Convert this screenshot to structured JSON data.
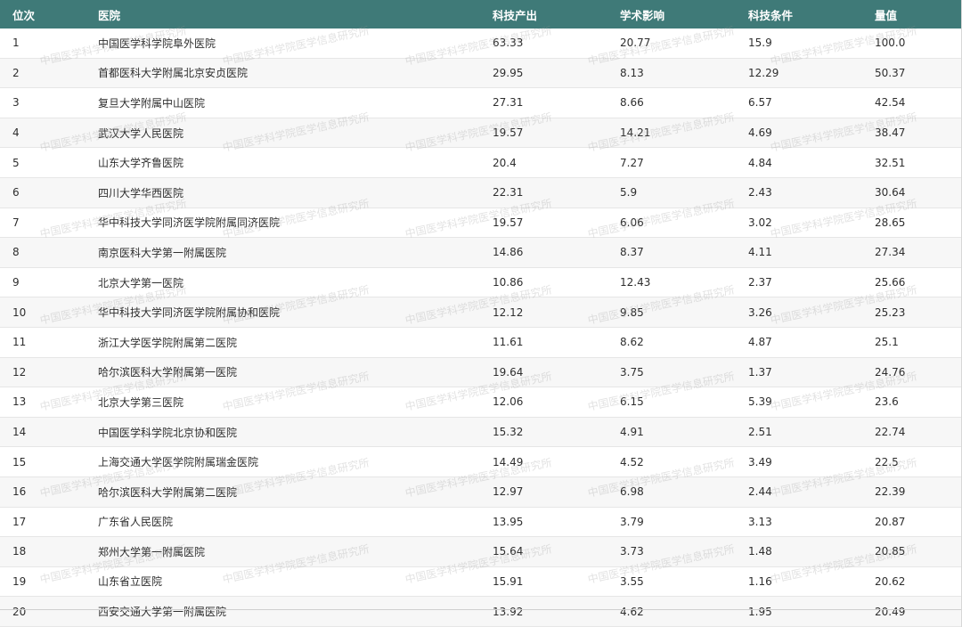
{
  "columns": {
    "rank": "位次",
    "hospital": "医院",
    "output": "科技产出",
    "academic": "学术影响",
    "conditions": "科技条件",
    "score": "量值"
  },
  "watermark_text": "中国医学科学院医学信息研究所",
  "colors": {
    "header_bg": "#3f7a78",
    "header_text": "#ffffff",
    "alt_row_bg": "#f7f7f7"
  },
  "rows": [
    {
      "rank": "1",
      "hospital": "中国医学科学院阜外医院",
      "output": "63.33",
      "academic": "20.77",
      "conditions": "15.9",
      "score": "100.0"
    },
    {
      "rank": "2",
      "hospital": "首都医科大学附属北京安贞医院",
      "output": "29.95",
      "academic": "8.13",
      "conditions": "12.29",
      "score": "50.37"
    },
    {
      "rank": "3",
      "hospital": "复旦大学附属中山医院",
      "output": "27.31",
      "academic": "8.66",
      "conditions": "6.57",
      "score": "42.54"
    },
    {
      "rank": "4",
      "hospital": "武汉大学人民医院",
      "output": "19.57",
      "academic": "14.21",
      "conditions": "4.69",
      "score": "38.47"
    },
    {
      "rank": "5",
      "hospital": "山东大学齐鲁医院",
      "output": "20.4",
      "academic": "7.27",
      "conditions": "4.84",
      "score": "32.51"
    },
    {
      "rank": "6",
      "hospital": "四川大学华西医院",
      "output": "22.31",
      "academic": "5.9",
      "conditions": "2.43",
      "score": "30.64"
    },
    {
      "rank": "7",
      "hospital": "华中科技大学同济医学院附属同济医院",
      "output": "19.57",
      "academic": "6.06",
      "conditions": "3.02",
      "score": "28.65"
    },
    {
      "rank": "8",
      "hospital": "南京医科大学第一附属医院",
      "output": "14.86",
      "academic": "8.37",
      "conditions": "4.11",
      "score": "27.34"
    },
    {
      "rank": "9",
      "hospital": "北京大学第一医院",
      "output": "10.86",
      "academic": "12.43",
      "conditions": "2.37",
      "score": "25.66"
    },
    {
      "rank": "10",
      "hospital": "华中科技大学同济医学院附属协和医院",
      "output": "12.12",
      "academic": "9.85",
      "conditions": "3.26",
      "score": "25.23"
    },
    {
      "rank": "11",
      "hospital": "浙江大学医学院附属第二医院",
      "output": "11.61",
      "academic": "8.62",
      "conditions": "4.87",
      "score": "25.1"
    },
    {
      "rank": "12",
      "hospital": "哈尔滨医科大学附属第一医院",
      "output": "19.64",
      "academic": "3.75",
      "conditions": "1.37",
      "score": "24.76"
    },
    {
      "rank": "13",
      "hospital": "北京大学第三医院",
      "output": "12.06",
      "academic": "6.15",
      "conditions": "5.39",
      "score": "23.6"
    },
    {
      "rank": "14",
      "hospital": "中国医学科学院北京协和医院",
      "output": "15.32",
      "academic": "4.91",
      "conditions": "2.51",
      "score": "22.74"
    },
    {
      "rank": "15",
      "hospital": "上海交通大学医学院附属瑞金医院",
      "output": "14.49",
      "academic": "4.52",
      "conditions": "3.49",
      "score": "22.5"
    },
    {
      "rank": "16",
      "hospital": "哈尔滨医科大学附属第二医院",
      "output": "12.97",
      "academic": "6.98",
      "conditions": "2.44",
      "score": "22.39"
    },
    {
      "rank": "17",
      "hospital": "广东省人民医院",
      "output": "13.95",
      "academic": "3.79",
      "conditions": "3.13",
      "score": "20.87"
    },
    {
      "rank": "18",
      "hospital": "郑州大学第一附属医院",
      "output": "15.64",
      "academic": "3.73",
      "conditions": "1.48",
      "score": "20.85"
    },
    {
      "rank": "19",
      "hospital": "山东省立医院",
      "output": "15.91",
      "academic": "3.55",
      "conditions": "1.16",
      "score": "20.62"
    },
    {
      "rank": "20",
      "hospital": "西安交通大学第一附属医院",
      "output": "13.92",
      "academic": "4.62",
      "conditions": "1.95",
      "score": "20.49"
    }
  ]
}
